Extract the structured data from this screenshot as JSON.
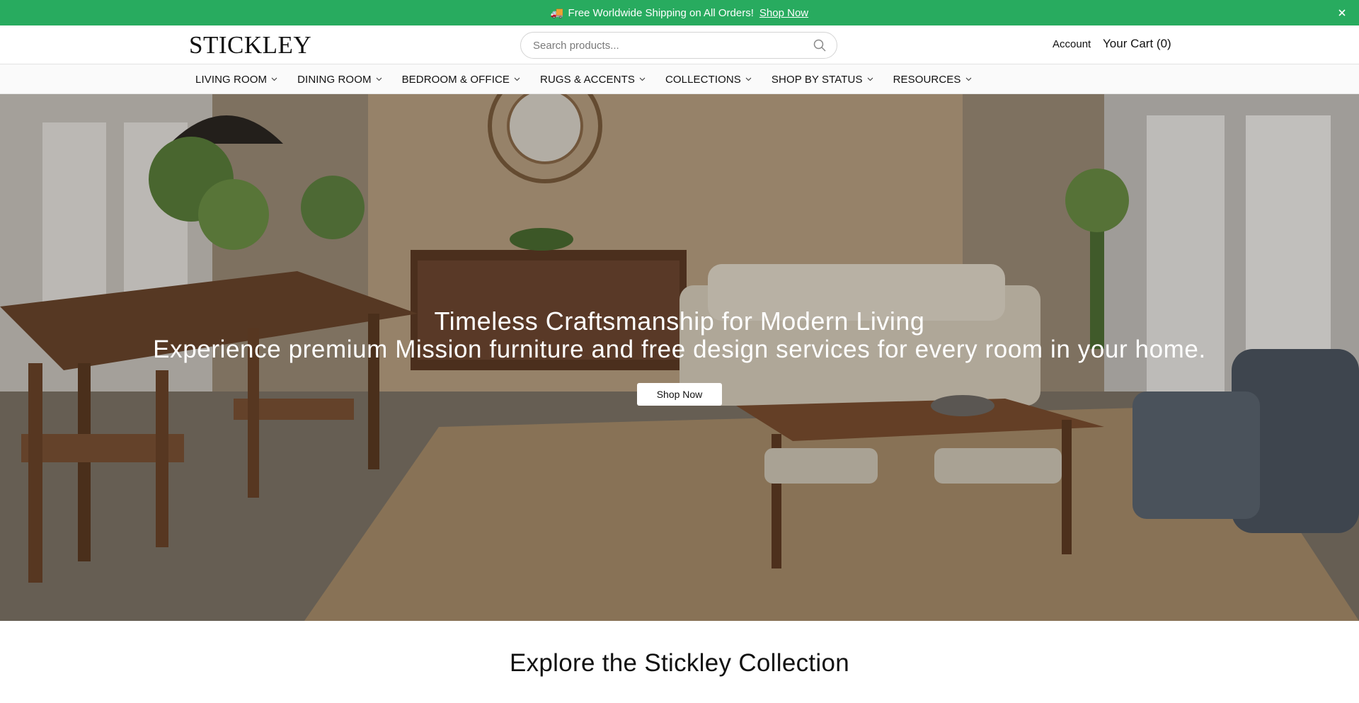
{
  "announcement": {
    "message": "Free Worldwide Shipping on All Orders!",
    "link_label": "Shop Now",
    "truck_icon": "🚚",
    "close_icon": "close-icon",
    "bg_color": "#28ab5f"
  },
  "header": {
    "logo": "STICKLEY",
    "search_placeholder": "Search products...",
    "account_label": "Account",
    "cart_label": "Your Cart (0)"
  },
  "nav": {
    "items": [
      {
        "label": "LIVING ROOM"
      },
      {
        "label": "DINING ROOM"
      },
      {
        "label": "BEDROOM & OFFICE"
      },
      {
        "label": "RUGS & ACCENTS"
      },
      {
        "label": "COLLECTIONS"
      },
      {
        "label": "SHOP BY STATUS"
      },
      {
        "label": "RESOURCES"
      }
    ]
  },
  "hero": {
    "title": "Timeless Craftsmanship for Modern Living",
    "subtitle": "Experience premium Mission furniture and free design services for every room in your home.",
    "cta_label": "Shop Now"
  },
  "collection": {
    "title": "Explore the Stickley Collection"
  }
}
